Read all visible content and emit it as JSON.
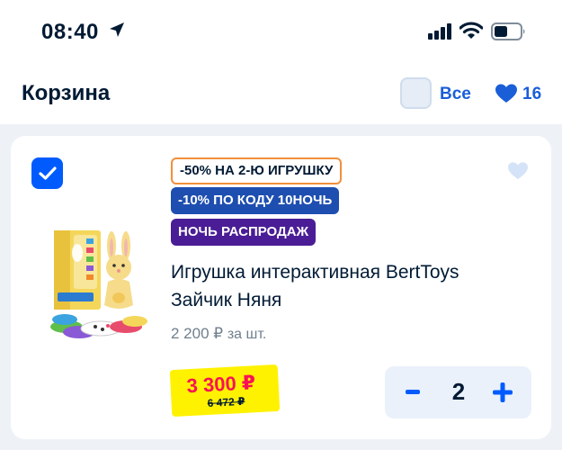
{
  "status_bar": {
    "time": "08:40",
    "icons": [
      "location-arrow-icon",
      "signal-icon",
      "wifi-icon",
      "battery-icon"
    ]
  },
  "header": {
    "title": "Корзина",
    "select_all_label": "Все",
    "favorites_count": "16"
  },
  "cart_item": {
    "selected": true,
    "badges": [
      "-50% НА 2-Ю ИГРУШКУ",
      "-10% ПО КОДУ 10НОЧЬ",
      "НОЧЬ РАСПРОДАЖ"
    ],
    "name_line1": "Игрушка интерактивная BertToys",
    "name_line2": "Зайчик Няня",
    "unit_price": "2 200 ₽",
    "unit_price_suffix": "за шт.",
    "price_current": "3 300 ₽",
    "price_old": "6 472 ₽",
    "quantity": "2"
  },
  "colors": {
    "accent_blue": "#005bff",
    "price_red": "#f91155",
    "price_tag_yellow": "#fff200",
    "badge_blue": "#1e4eb0",
    "badge_purple": "#4a1d96",
    "badge_outline_orange": "#f28f3b"
  }
}
